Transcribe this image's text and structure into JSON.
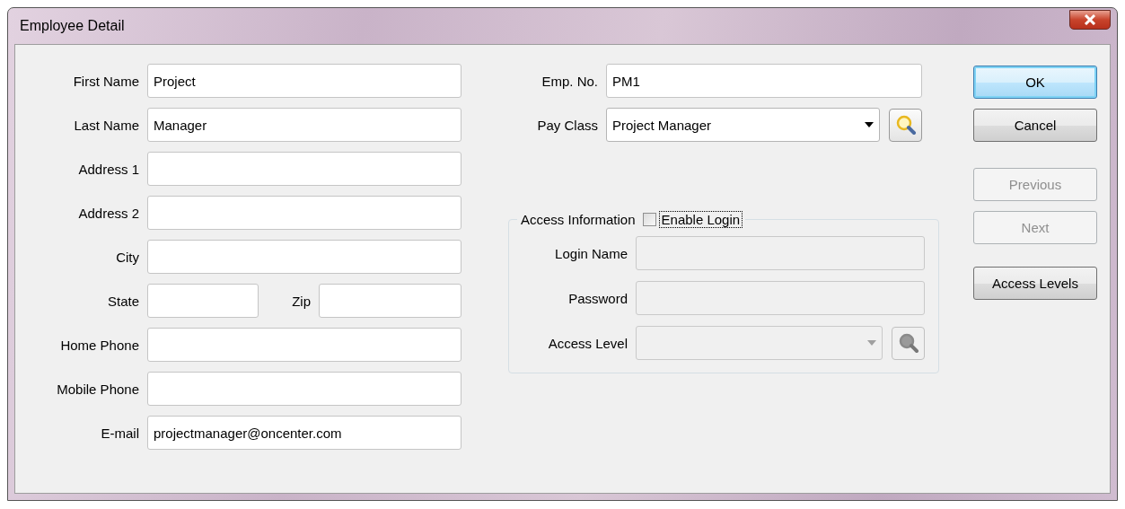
{
  "window": {
    "title": "Employee Detail"
  },
  "personal": [
    {
      "kind": "single",
      "label": "First Name",
      "value": "Project"
    },
    {
      "kind": "single",
      "label": "Last Name",
      "value": "Manager"
    },
    {
      "kind": "single",
      "label": "Address 1"
    },
    {
      "kind": "single",
      "label": "Address 2"
    },
    {
      "kind": "single",
      "label": "City"
    },
    {
      "kind": "pair",
      "fields": [
        {
          "label": "State"
        },
        {
          "label": "Zip"
        }
      ]
    },
    {
      "kind": "single",
      "label": "Home Phone"
    },
    {
      "kind": "single",
      "label": "Mobile Phone"
    },
    {
      "kind": "single",
      "label": "E-mail",
      "value": "projectmanager@oncenter.com"
    }
  ],
  "job": [
    {
      "kind": "text",
      "label": "Emp. No.",
      "value": "PM1"
    },
    {
      "kind": "combo",
      "label": "Pay Class",
      "value": "Project Manager",
      "lookup": true
    }
  ],
  "access": {
    "title": "Access Information",
    "enable_login": {
      "label": "Enable Login",
      "checked": false,
      "focused": true
    },
    "fields": [
      {
        "kind": "text",
        "label": "Login Name",
        "disabled": true
      },
      {
        "kind": "text",
        "label": "Password",
        "disabled": true
      },
      {
        "kind": "combo",
        "label": "Access Level",
        "disabled": true,
        "lookup": true
      }
    ]
  },
  "buttons": [
    {
      "label": "OK",
      "default": true,
      "disabled": false
    },
    {
      "label": "Cancel",
      "default": false,
      "disabled": false
    },
    {
      "label": "Previous",
      "default": false,
      "disabled": true
    },
    {
      "label": "Next",
      "default": false,
      "disabled": true
    },
    {
      "label": "Access Levels",
      "default": false,
      "disabled": false
    }
  ]
}
